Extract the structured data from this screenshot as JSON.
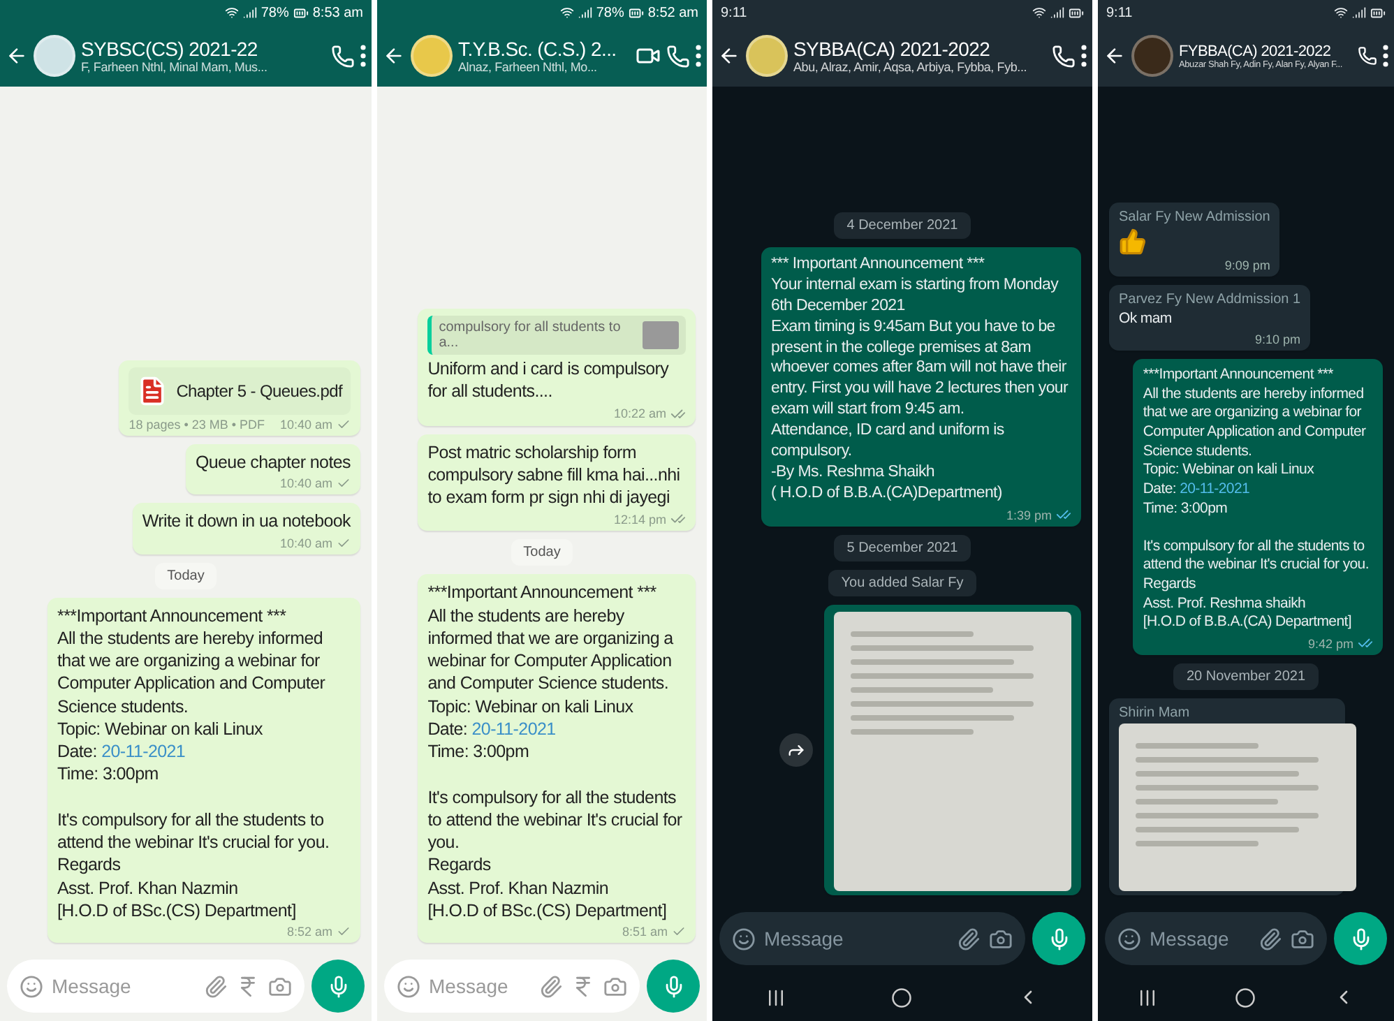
{
  "phones": [
    {
      "kind": "light",
      "status": {
        "time": "8:53 am",
        "battery": "78%"
      },
      "header": {
        "title": "SYBSC(CS) 2021-22",
        "members": "F, Farheen Nthl, Minal Mam, Mus...",
        "avatar": {
          "color": "#cfe3e6"
        },
        "actions": [
          {
            "kind": "call"
          },
          {
            "kind": "menu"
          }
        ]
      },
      "messages": [
        {
          "kind": "document",
          "from_me": true,
          "file": "Chapter 5 - Queues.pdf",
          "meta": "18 pages • 23 MB • PDF",
          "time": "10:40 am",
          "delivered": false
        },
        {
          "kind": "text",
          "from_me": true,
          "parts": [
            {
              "text": "Queue chapter notes",
              "link": false
            }
          ],
          "time": "10:40 am",
          "delivered": false
        },
        {
          "kind": "text",
          "from_me": true,
          "parts": [
            {
              "text": "Write it down in ua notebook",
              "link": false
            }
          ],
          "time": "10:40 am",
          "delivered": false
        },
        {
          "kind": "date",
          "text": "Today"
        },
        {
          "kind": "text",
          "from_me": true,
          "parts": [
            {
              "text": "***Important Announcement ***\nAll the students are hereby informed that we are organizing a webinar for Computer Application and Computer Science students.\nTopic: Webinar on kali Linux\nDate: ",
              "link": false
            },
            {
              "text": "20-11-2021",
              "link": true
            },
            {
              "text": "\nTime: 3:00pm\n\nIt's compulsory for all the students to attend the webinar It's crucial for you.\nRegards\nAsst. Prof. Khan Nazmin\n[H.O.D of BSc.(CS) Department]",
              "link": false
            }
          ],
          "time": "8:52 am",
          "delivered": false
        }
      ],
      "input": {
        "placeholder": "Message",
        "tools": [
          {
            "kind": "attach"
          },
          {
            "kind": "rupee"
          },
          {
            "kind": "camera"
          }
        ]
      }
    },
    {
      "kind": "light",
      "status": {
        "time": "8:52 am",
        "battery": "78%"
      },
      "header": {
        "title": "T.Y.B.Sc. (C.S.) 2...",
        "members": "Alnaz, Farheen Nthl, Mo...",
        "avatar": {
          "color": "#e8c84a"
        },
        "actions": [
          {
            "kind": "video"
          },
          {
            "kind": "call"
          },
          {
            "kind": "menu"
          }
        ]
      },
      "messages": [
        {
          "kind": "text",
          "from_me": true,
          "quote": "compulsory for all students to a...",
          "parts": [
            {
              "text": "Uniform and i card is compulsory for all students....",
              "link": false
            }
          ],
          "time": "10:22 am",
          "delivered": true
        },
        {
          "kind": "text",
          "from_me": true,
          "parts": [
            {
              "text": "Post matric scholarship form compulsory sabne fill kma hai...nhi to exam form pr sign nhi di jayegi",
              "link": false
            }
          ],
          "time": "12:14 pm",
          "delivered": true
        },
        {
          "kind": "date",
          "text": "Today"
        },
        {
          "kind": "text",
          "from_me": true,
          "parts": [
            {
              "text": "***Important Announcement ***\nAll the students are hereby informed that we are organizing a webinar for Computer Application and Computer Science students.\nTopic: Webinar on kali Linux\nDate: ",
              "link": false
            },
            {
              "text": "20-11-2021",
              "link": true
            },
            {
              "text": "\nTime: 3:00pm\n\nIt's compulsory for all the students to attend the webinar It's crucial for you.\nRegards\nAsst. Prof. Khan Nazmin\n[H.O.D of BSc.(CS) Department]",
              "link": false
            }
          ],
          "time": "8:51 am",
          "delivered": false
        }
      ],
      "input": {
        "placeholder": "Message",
        "tools": [
          {
            "kind": "attach"
          },
          {
            "kind": "rupee"
          },
          {
            "kind": "camera"
          }
        ]
      }
    },
    {
      "kind": "dark",
      "status": {
        "time": "9:11"
      },
      "header": {
        "title": "SYBBA(CA) 2021-2022",
        "members": "Abu, Alraz, Amir, Aqsa, Arbiya, Fybba, Fyb...",
        "avatar": {
          "color": "#d9c35a"
        },
        "actions": [
          {
            "kind": "call"
          },
          {
            "kind": "menu"
          }
        ]
      },
      "messages": [
        {
          "kind": "date",
          "text": "4 December 2021"
        },
        {
          "kind": "text",
          "from_me": true,
          "parts": [
            {
              "text": "*** Important Announcement ***\nYour internal exam is starting from Monday 6th December 2021\nExam timing is 9:45am But you have to be present in the college premises at 8am whoever comes after 8am will not have their entry. First you will have 2 lectures then your exam will start from 9:45 am.\nAttendance, ID card and uniform is compulsory.\n-By Ms. Reshma Shaikh\n( H.O.D of B.B.A.(CA)Department)",
              "link": false
            }
          ],
          "time": "1:39 pm",
          "delivered": true
        },
        {
          "kind": "date",
          "text": "5 December 2021"
        },
        {
          "kind": "date",
          "text": "You added Salar Fy"
        },
        {
          "kind": "image",
          "from_me": true,
          "forward": true
        }
      ],
      "input": {
        "placeholder": "Message",
        "tools": [
          {
            "kind": "attach"
          },
          {
            "kind": "camera"
          }
        ]
      }
    },
    {
      "kind": "dark",
      "status": {
        "time": "9:11"
      },
      "header": {
        "title": "FYBBA(CA) 2021-2022",
        "members": "Abuzar Shah Fy, Adin Fy, Alan Fy, Alyan F...",
        "avatar": {
          "color": "#3a2a1a"
        },
        "actions": [
          {
            "kind": "call"
          },
          {
            "kind": "menu"
          }
        ]
      },
      "messages": [
        {
          "kind": "like",
          "from_me": false,
          "sender": "Salar Fy New Admission",
          "time": "9:09 pm"
        },
        {
          "kind": "text",
          "from_me": false,
          "sender": "Parvez Fy New Addmission 1",
          "parts": [
            {
              "text": "Ok mam",
              "link": false
            }
          ],
          "time": "9:10 pm"
        },
        {
          "kind": "text",
          "from_me": true,
          "parts": [
            {
              "text": "***Important Announcement ***\nAll the students are hereby informed that we are organizing a webinar for Computer Application and Computer Science students.\nTopic: Webinar on kali Linux\nDate: ",
              "link": false
            },
            {
              "text": "20-11-2021",
              "link": true
            },
            {
              "text": "\nTime: 3:00pm\n\nIt's compulsory for all the students to attend the webinar It's crucial for you.\nRegards\nAsst. Prof. Reshma shaikh\n[H.O.D of B.B.A.(CA) Department]",
              "link": false
            }
          ],
          "time": "9:42 pm",
          "delivered": true
        },
        {
          "kind": "date",
          "text": "20 November 2021"
        },
        {
          "kind": "image",
          "from_me": false,
          "sender": "Shirin Mam",
          "forward": false
        }
      ],
      "input": {
        "placeholder": "Message",
        "tools": [
          {
            "kind": "attach"
          },
          {
            "kind": "camera"
          }
        ]
      }
    }
  ]
}
